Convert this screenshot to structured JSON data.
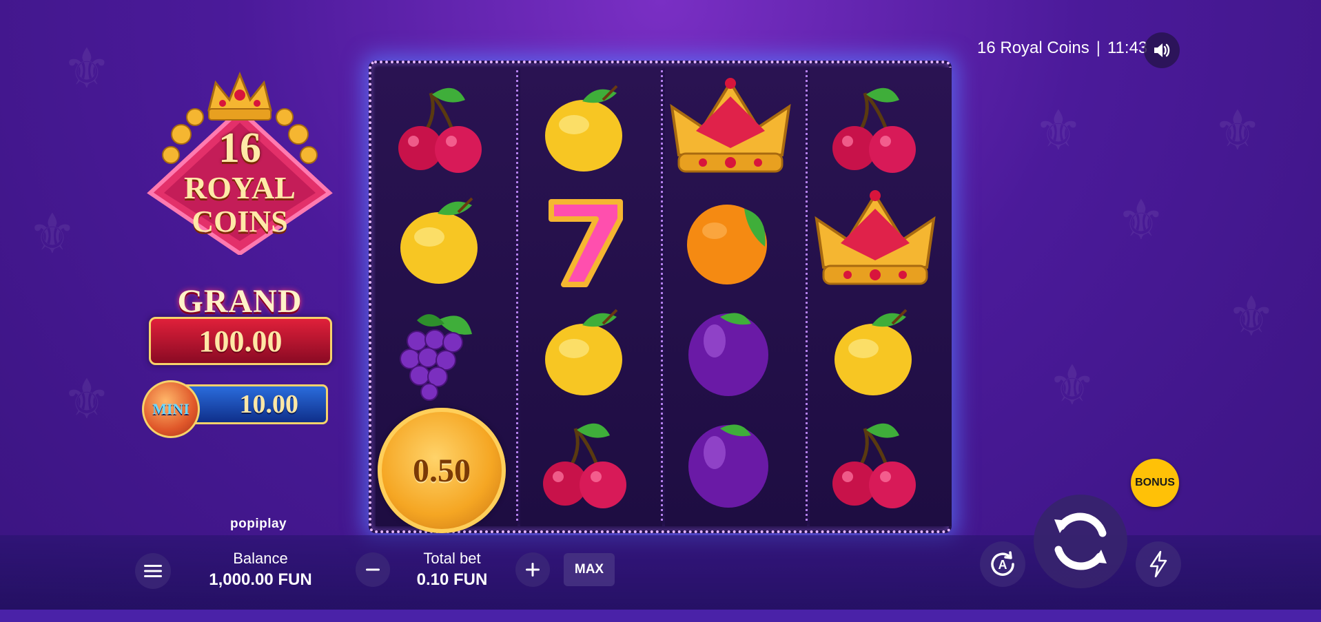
{
  "header": {
    "game_title": "16 Royal Coins",
    "separator": "|",
    "time": "11:43",
    "sound_icon": "speaker-icon"
  },
  "logo": {
    "number": "16",
    "line1": "ROYAL",
    "line2": "COINS"
  },
  "jackpots": {
    "grand": {
      "label": "GRAND",
      "value": "100.00"
    },
    "mini": {
      "label": "MINI",
      "value": "10.00"
    }
  },
  "provider": "popiplay",
  "reels": [
    [
      "cherry",
      "lemon",
      "grapes",
      "coin"
    ],
    [
      "lemon",
      "seven",
      "lemon",
      "cherry"
    ],
    [
      "crown",
      "orange",
      "plum",
      "plum"
    ],
    [
      "cherry",
      "crown",
      "lemon",
      "cherry"
    ]
  ],
  "coin_value": "0.50",
  "controls": {
    "menu_icon": "hamburger-menu-icon",
    "balance_label": "Balance",
    "balance_value": "1,000.00 FUN",
    "total_bet_label": "Total bet",
    "total_bet_value": "0.10 FUN",
    "minus_icon": "minus-icon",
    "plus_icon": "plus-icon",
    "max_label": "MAX",
    "bonus_label": "BONUS",
    "auto_icon": "autoplay-icon",
    "spin_icon": "spin-icon",
    "turbo_icon": "lightning-icon"
  },
  "colors": {
    "accent_gold": "#ffc107",
    "reel_border": "#e5b7ff",
    "background": "#4b1a9a"
  }
}
